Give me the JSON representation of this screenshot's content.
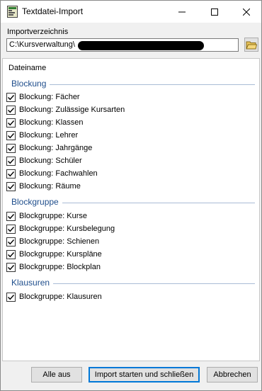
{
  "window": {
    "title": "Textdatei-Import"
  },
  "import": {
    "label": "Importverzeichnis",
    "path": "C:\\Kursverwaltung\\"
  },
  "list": {
    "column_header": "Dateiname",
    "groups": [
      {
        "title": "Blockung",
        "items": [
          {
            "label": "Blockung: Fächer",
            "checked": true
          },
          {
            "label": "Blockung: Zulässige Kursarten",
            "checked": true
          },
          {
            "label": "Blockung: Klassen",
            "checked": true
          },
          {
            "label": "Blockung: Lehrer",
            "checked": true
          },
          {
            "label": "Blockung: Jahrgänge",
            "checked": true
          },
          {
            "label": "Blockung: Schüler",
            "checked": true
          },
          {
            "label": "Blockung: Fachwahlen",
            "checked": true
          },
          {
            "label": "Blockung: Räume",
            "checked": true
          }
        ]
      },
      {
        "title": "Blockgruppe",
        "items": [
          {
            "label": "Blockgruppe: Kurse",
            "checked": true
          },
          {
            "label": "Blockgruppe: Kursbelegung",
            "checked": true
          },
          {
            "label": "Blockgruppe: Schienen",
            "checked": true
          },
          {
            "label": "Blockgruppe: Kurspläne",
            "checked": true
          },
          {
            "label": "Blockgruppe: Blockplan",
            "checked": true
          }
        ]
      },
      {
        "title": "Klausuren",
        "items": [
          {
            "label": "Blockgruppe: Klausuren",
            "checked": true
          }
        ]
      }
    ]
  },
  "buttons": {
    "none": "Alle aus",
    "start": "Import starten und schließen",
    "cancel": "Abbrechen"
  }
}
